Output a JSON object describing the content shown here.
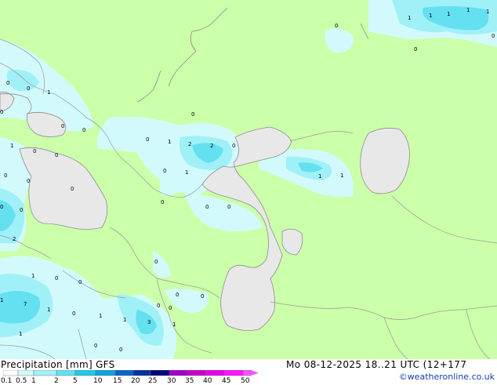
{
  "title": "Precipitation [mm] GFS",
  "valid_time": "Mo 08-12-2025 18..21 UTC (12+177",
  "credit": "©weatheronline.co.uk",
  "colors": {
    "land": "#ccffaa",
    "water": "#e8e8e8",
    "border": "#999999",
    "coast": "#8c8c8c"
  },
  "legend": {
    "ticks": [
      "0.1",
      "0.5",
      "1",
      "2",
      "5",
      "10",
      "15",
      "20",
      "25",
      "30",
      "35",
      "40",
      "45",
      "50"
    ],
    "colors": [
      "#ffffff",
      "#d2fafc",
      "#a0f0f8",
      "#64e0f0",
      "#1ec8e8",
      "#14a0dc",
      "#0a64c8",
      "#0032a0",
      "#000078",
      "#a000c8",
      "#c800c8",
      "#e600e6",
      "#ff14ff",
      "#ff50ff"
    ]
  },
  "values": [
    "1",
    "1",
    "1",
    "1",
    "1",
    "0",
    "0",
    "0",
    "0",
    "0",
    "2",
    "2",
    "1",
    "0",
    "0",
    "1",
    "0",
    "0",
    "0",
    "0",
    "0",
    "0",
    "0",
    "0",
    "0",
    "1",
    "1",
    "0",
    "0",
    "0",
    "0",
    "0",
    "0",
    "0",
    "0",
    "0",
    "2",
    "1",
    "0",
    "0",
    "7",
    "1",
    "1",
    "0",
    "0",
    "0",
    "1",
    "1",
    "3",
    "1",
    "0",
    "0",
    "1",
    "1",
    "1"
  ]
}
